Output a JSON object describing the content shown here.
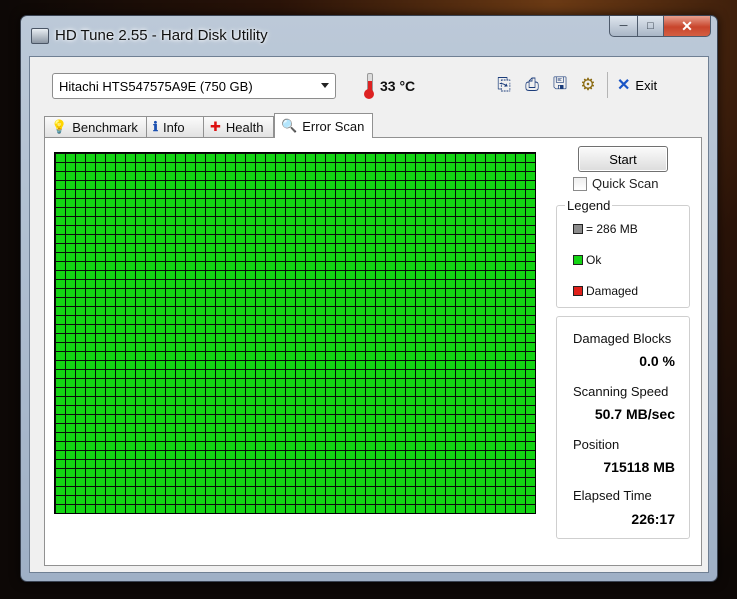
{
  "window": {
    "title": "HD Tune 2.55 - Hard Disk Utility",
    "caption": {
      "minimize": "─",
      "maximize": "□",
      "close": "✕"
    }
  },
  "toolbar": {
    "drive": "Hitachi HTS547575A9E (750 GB)",
    "temperature": "33 °C",
    "buttons": [
      {
        "name": "copy-text-icon",
        "glyph": "⎘"
      },
      {
        "name": "copy-screenshot-icon",
        "glyph": "⎙"
      },
      {
        "name": "save-icon",
        "glyph": "🖫"
      },
      {
        "name": "options-icon",
        "glyph": "⚙"
      }
    ],
    "exit_label": "Exit",
    "exit_glyph": "✕"
  },
  "tabs": [
    {
      "label": "Benchmark",
      "icon": "💡"
    },
    {
      "label": "Info",
      "icon": "ℹ"
    },
    {
      "label": "Health",
      "icon": "✚"
    },
    {
      "label": "Error Scan",
      "icon": "🔍",
      "active": true
    }
  ],
  "scan": {
    "start_label": "Start",
    "quick_scan_label": "Quick Scan",
    "quick_scan_checked": false,
    "block_status": "ok",
    "colors": {
      "ok": "#13d413",
      "block": "#8c8c8c",
      "damaged": "#e0201a"
    }
  },
  "legend": {
    "title": "Legend",
    "block_size": "= 286 MB",
    "ok": "Ok",
    "damaged": "Damaged"
  },
  "stats": {
    "damaged_blocks_label": "Damaged Blocks",
    "damaged_blocks_value": "0.0 %",
    "scanning_speed_label": "Scanning Speed",
    "scanning_speed_value": "50.7 MB/sec",
    "position_label": "Position",
    "position_value": "715118 MB",
    "elapsed_time_label": "Elapsed Time",
    "elapsed_time_value": "226:17"
  }
}
